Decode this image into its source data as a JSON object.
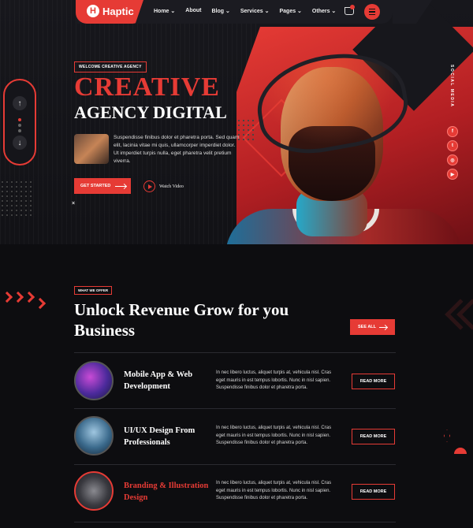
{
  "nav": {
    "logo_mark": "H",
    "logo_text": "Haptic",
    "menu": [
      "Home ⌄",
      "About",
      "Blog ⌄",
      "Services ⌄",
      "Pages ⌄",
      "Others ⌄"
    ],
    "cart_count": "0"
  },
  "hero": {
    "badge": "WELCOME CREATIVE AGENCY",
    "title_line1": "CREATIVE",
    "title_line2": "AGENCY DIGITAL",
    "description": "Suspendisse finibus dolor et pharetra porta. Sed quam elit, lacinia vitae mi quis, ullamcorper imperdiet dolor. Ut imperdiet turpis nulla, eget pharetra velit pretium viverra.",
    "cta_label": "GET STARTED",
    "watch_label": "Watch Video",
    "close_glyph": "×"
  },
  "slider": {
    "up": "↑",
    "down": "↓",
    "dots": 3,
    "active_dot": 0
  },
  "social": {
    "label": "SOCIAL MEDIA",
    "icons": [
      "facebook-icon",
      "twitter-icon",
      "instagram-icon",
      "youtube-icon"
    ],
    "glyphs": [
      "f",
      "t",
      "◎",
      "▶"
    ]
  },
  "services": {
    "badge": "WHAT WE OFFER",
    "title": "Unlock Revenue Grow for you Business",
    "see_all": "SEE ALL",
    "items": [
      {
        "title": "Mobile App & Web Development",
        "description": "In nec libero luctus, aliquet turpis at, vehicula nisl. Cras eget mauris in est tempus lobortis. Nunc in nisl sapien. Suspendisse finibus dolor et pharetra porta.",
        "button": "READ MORE"
      },
      {
        "title": "UI/UX Design From Professionals",
        "description": "In nec libero luctus, aliquet turpis at, vehicula nisl. Cras eget mauris in est tempus lobortis. Nunc in nisl sapien. Suspendisse finibus dolor et pharetra porta.",
        "button": "READ MORE"
      },
      {
        "title": "Branding & Illustration Design",
        "description": "In nec libero luctus, aliquet turpis at, vehicula nisl. Cras eget mauris in est tempus lobortis. Nunc in nisl sapien. Suspendisse finibus dolor et pharetra porta.",
        "button": "READ MORE"
      }
    ]
  },
  "colors": {
    "accent": "#e63b35",
    "background": "#0c0c0f",
    "surface": "#1b1b21"
  }
}
